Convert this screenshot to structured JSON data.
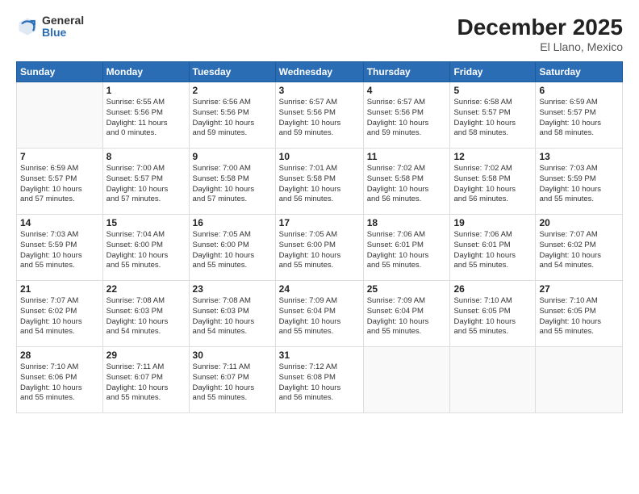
{
  "logo": {
    "general": "General",
    "blue": "Blue"
  },
  "header": {
    "month_year": "December 2025",
    "location": "El Llano, Mexico"
  },
  "weekdays": [
    "Sunday",
    "Monday",
    "Tuesday",
    "Wednesday",
    "Thursday",
    "Friday",
    "Saturday"
  ],
  "weeks": [
    [
      {
        "day": "",
        "info": ""
      },
      {
        "day": "1",
        "info": "Sunrise: 6:55 AM\nSunset: 5:56 PM\nDaylight: 11 hours\nand 0 minutes."
      },
      {
        "day": "2",
        "info": "Sunrise: 6:56 AM\nSunset: 5:56 PM\nDaylight: 10 hours\nand 59 minutes."
      },
      {
        "day": "3",
        "info": "Sunrise: 6:57 AM\nSunset: 5:56 PM\nDaylight: 10 hours\nand 59 minutes."
      },
      {
        "day": "4",
        "info": "Sunrise: 6:57 AM\nSunset: 5:56 PM\nDaylight: 10 hours\nand 59 minutes."
      },
      {
        "day": "5",
        "info": "Sunrise: 6:58 AM\nSunset: 5:57 PM\nDaylight: 10 hours\nand 58 minutes."
      },
      {
        "day": "6",
        "info": "Sunrise: 6:59 AM\nSunset: 5:57 PM\nDaylight: 10 hours\nand 58 minutes."
      }
    ],
    [
      {
        "day": "7",
        "info": "Sunrise: 6:59 AM\nSunset: 5:57 PM\nDaylight: 10 hours\nand 57 minutes."
      },
      {
        "day": "8",
        "info": "Sunrise: 7:00 AM\nSunset: 5:57 PM\nDaylight: 10 hours\nand 57 minutes."
      },
      {
        "day": "9",
        "info": "Sunrise: 7:00 AM\nSunset: 5:58 PM\nDaylight: 10 hours\nand 57 minutes."
      },
      {
        "day": "10",
        "info": "Sunrise: 7:01 AM\nSunset: 5:58 PM\nDaylight: 10 hours\nand 56 minutes."
      },
      {
        "day": "11",
        "info": "Sunrise: 7:02 AM\nSunset: 5:58 PM\nDaylight: 10 hours\nand 56 minutes."
      },
      {
        "day": "12",
        "info": "Sunrise: 7:02 AM\nSunset: 5:58 PM\nDaylight: 10 hours\nand 56 minutes."
      },
      {
        "day": "13",
        "info": "Sunrise: 7:03 AM\nSunset: 5:59 PM\nDaylight: 10 hours\nand 55 minutes."
      }
    ],
    [
      {
        "day": "14",
        "info": "Sunrise: 7:03 AM\nSunset: 5:59 PM\nDaylight: 10 hours\nand 55 minutes."
      },
      {
        "day": "15",
        "info": "Sunrise: 7:04 AM\nSunset: 6:00 PM\nDaylight: 10 hours\nand 55 minutes."
      },
      {
        "day": "16",
        "info": "Sunrise: 7:05 AM\nSunset: 6:00 PM\nDaylight: 10 hours\nand 55 minutes."
      },
      {
        "day": "17",
        "info": "Sunrise: 7:05 AM\nSunset: 6:00 PM\nDaylight: 10 hours\nand 55 minutes."
      },
      {
        "day": "18",
        "info": "Sunrise: 7:06 AM\nSunset: 6:01 PM\nDaylight: 10 hours\nand 55 minutes."
      },
      {
        "day": "19",
        "info": "Sunrise: 7:06 AM\nSunset: 6:01 PM\nDaylight: 10 hours\nand 55 minutes."
      },
      {
        "day": "20",
        "info": "Sunrise: 7:07 AM\nSunset: 6:02 PM\nDaylight: 10 hours\nand 54 minutes."
      }
    ],
    [
      {
        "day": "21",
        "info": "Sunrise: 7:07 AM\nSunset: 6:02 PM\nDaylight: 10 hours\nand 54 minutes."
      },
      {
        "day": "22",
        "info": "Sunrise: 7:08 AM\nSunset: 6:03 PM\nDaylight: 10 hours\nand 54 minutes."
      },
      {
        "day": "23",
        "info": "Sunrise: 7:08 AM\nSunset: 6:03 PM\nDaylight: 10 hours\nand 54 minutes."
      },
      {
        "day": "24",
        "info": "Sunrise: 7:09 AM\nSunset: 6:04 PM\nDaylight: 10 hours\nand 55 minutes."
      },
      {
        "day": "25",
        "info": "Sunrise: 7:09 AM\nSunset: 6:04 PM\nDaylight: 10 hours\nand 55 minutes."
      },
      {
        "day": "26",
        "info": "Sunrise: 7:10 AM\nSunset: 6:05 PM\nDaylight: 10 hours\nand 55 minutes."
      },
      {
        "day": "27",
        "info": "Sunrise: 7:10 AM\nSunset: 6:05 PM\nDaylight: 10 hours\nand 55 minutes."
      }
    ],
    [
      {
        "day": "28",
        "info": "Sunrise: 7:10 AM\nSunset: 6:06 PM\nDaylight: 10 hours\nand 55 minutes."
      },
      {
        "day": "29",
        "info": "Sunrise: 7:11 AM\nSunset: 6:07 PM\nDaylight: 10 hours\nand 55 minutes."
      },
      {
        "day": "30",
        "info": "Sunrise: 7:11 AM\nSunset: 6:07 PM\nDaylight: 10 hours\nand 55 minutes."
      },
      {
        "day": "31",
        "info": "Sunrise: 7:12 AM\nSunset: 6:08 PM\nDaylight: 10 hours\nand 56 minutes."
      },
      {
        "day": "",
        "info": ""
      },
      {
        "day": "",
        "info": ""
      },
      {
        "day": "",
        "info": ""
      }
    ]
  ]
}
